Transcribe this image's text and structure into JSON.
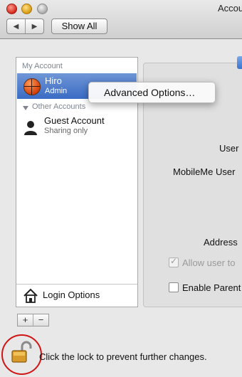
{
  "window": {
    "title": "Accou"
  },
  "toolbar": {
    "back_glyph": "◀",
    "forward_glyph": "▶",
    "show_all_label": "Show All"
  },
  "accounts": {
    "my_account_header": "My Account",
    "my_account": {
      "name": "Hiro",
      "role": "Admin",
      "icon": "basketball-avatar-icon"
    },
    "other_accounts_header": "Other Accounts",
    "others": [
      {
        "name": "Guest Account",
        "role": "Sharing only",
        "icon": "person-silhouette-icon"
      }
    ],
    "login_options_label": "Login Options",
    "add_label": "+",
    "remove_label": "−"
  },
  "context_menu": {
    "items": [
      "Advanced Options…"
    ]
  },
  "detail": {
    "user_label": "User",
    "mobileme_label": "MobileMe User",
    "address_label": "Address",
    "allow_user_label": "Allow user to",
    "allow_user_checked": true,
    "enable_parental_label": "Enable Parent",
    "enable_parental_checked": false
  },
  "lock": {
    "text": "Click the lock to prevent further changes.",
    "state": "unlocked",
    "highlight_color": "#d11515"
  },
  "colors": {
    "selection": "#3a6bc4"
  }
}
